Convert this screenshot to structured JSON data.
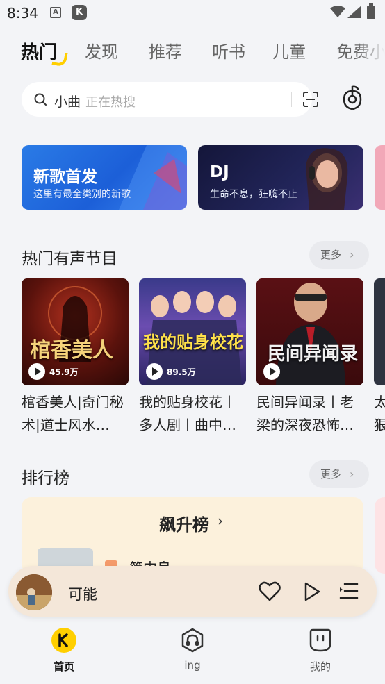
{
  "status": {
    "time": "8:34",
    "icon_a": "A",
    "icon_k": "K"
  },
  "tabs": [
    {
      "label": "热门"
    },
    {
      "label": "发现"
    },
    {
      "label": "推荐"
    },
    {
      "label": "听书"
    },
    {
      "label": "儿童"
    },
    {
      "label": "免费小"
    }
  ],
  "search": {
    "keyword": "小曲",
    "hint": "正在热搜"
  },
  "banners": [
    {
      "title": "新歌首发",
      "subtitle": "这里有最全类别的新歌"
    },
    {
      "title": "DJ",
      "subtitle": "生命不息，狂嗨不止"
    }
  ],
  "audio_section": {
    "title": "热门有声节目",
    "more": "更多",
    "items": [
      {
        "title": "棺香美人|奇门秘术|道士风水…",
        "plays": "45.9万",
        "cover_text": "棺香美人"
      },
      {
        "title": "我的贴身校花丨多人剧丨曲中…",
        "plays": "89.5万",
        "cover_text": "我的贴身校花"
      },
      {
        "title": "民间异闻录丨老梁的深夜恐怖…",
        "plays": "",
        "cover_text": "民间异闻录"
      },
      {
        "title": "太狠",
        "plays": "",
        "cover_text": ""
      }
    ]
  },
  "rank_section": {
    "title": "排行榜",
    "more": "更多",
    "card_title": "飙升榜",
    "first_song": "简中良"
  },
  "player": {
    "song": "可能"
  },
  "bottom_nav": [
    {
      "label": "首页"
    },
    {
      "label": "ing"
    },
    {
      "label": "我的"
    }
  ],
  "colors": {
    "accent": "#ffcf00",
    "background": "#f3f4f7",
    "player_bg": "#f4e7d9",
    "rank_card": "#fcf1dc"
  }
}
